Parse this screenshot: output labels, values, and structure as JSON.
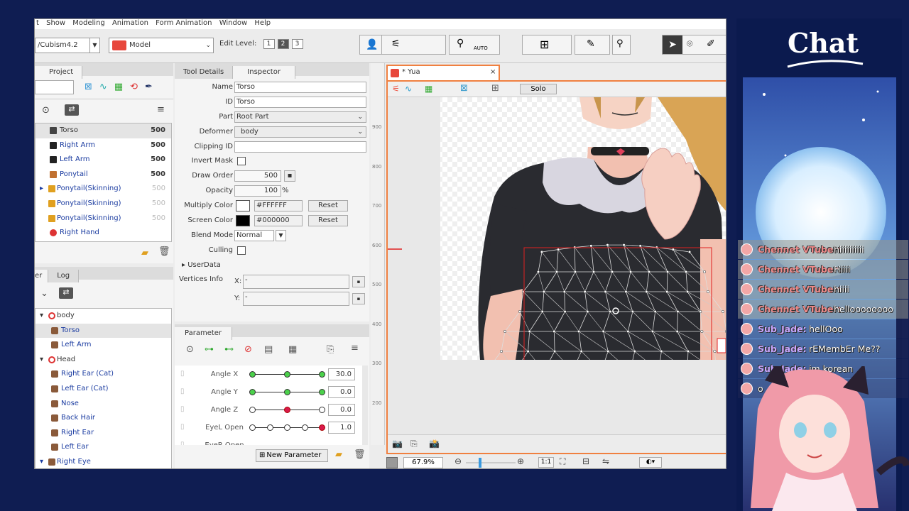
{
  "app": {
    "menu": [
      "t",
      "Show",
      "Modeling",
      "Animation",
      "Form Animation",
      "Window",
      "Help"
    ],
    "toolbar": {
      "project_path": "/Cubism4.2",
      "mode_select": "Model",
      "edit_level_label": "Edit Level:",
      "edit_levels": [
        "1",
        "2",
        "3"
      ],
      "active_edit_level": "2",
      "auto_label": "AUTO"
    },
    "project_panel": {
      "tab": "Project",
      "parts": [
        {
          "label": "Torso",
          "value": "500",
          "selected": true,
          "dim": false
        },
        {
          "label": "Right Arm",
          "value": "500",
          "selected": false,
          "dim": false
        },
        {
          "label": "Left Arm",
          "value": "500",
          "selected": false,
          "dim": false
        },
        {
          "label": "Ponytail",
          "value": "500",
          "selected": false,
          "dim": false
        },
        {
          "label": "Ponytail(Skinning)",
          "value": "500",
          "selected": false,
          "dim": true
        },
        {
          "label": "Ponytail(Skinning)",
          "value": "500",
          "selected": false,
          "dim": true
        },
        {
          "label": "Ponytail(Skinning)",
          "value": "500",
          "selected": false,
          "dim": true
        },
        {
          "label": "Right Hand",
          "value": "",
          "selected": false,
          "dim": false
        }
      ]
    },
    "deformer_panel": {
      "tabs": [
        "er",
        "Log"
      ],
      "items": [
        {
          "label": "body",
          "indent": 0,
          "color": "gray"
        },
        {
          "label": "Torso",
          "indent": 1,
          "color": "blue",
          "selected": true
        },
        {
          "label": "Left Arm",
          "indent": 1,
          "color": "blue"
        },
        {
          "label": "Head",
          "indent": 0,
          "color": "gray"
        },
        {
          "label": "Right Ear (Cat)",
          "indent": 1,
          "color": "blue"
        },
        {
          "label": "Left Ear (Cat)",
          "indent": 1,
          "color": "blue"
        },
        {
          "label": "Nose",
          "indent": 1,
          "color": "blue"
        },
        {
          "label": "Back Hair",
          "indent": 1,
          "color": "blue"
        },
        {
          "label": "Right Ear",
          "indent": 1,
          "color": "blue"
        },
        {
          "label": "Left Ear",
          "indent": 1,
          "color": "blue"
        },
        {
          "label": "Right Eye",
          "indent": 0,
          "color": "blue"
        }
      ]
    },
    "inspector": {
      "tabs": [
        "Tool Details",
        "Inspector"
      ],
      "name_label": "Name",
      "name": "Torso",
      "id_label": "ID",
      "id": "Torso",
      "part_label": "Part",
      "part": "Root Part",
      "deformer_label": "Deformer",
      "deformer": "body",
      "clipping_label": "Clipping ID",
      "clipping": "",
      "invert_mask_label": "Invert Mask",
      "draw_order_label": "Draw Order",
      "draw_order": "500",
      "opacity_label": "Opacity",
      "opacity": "100",
      "opacity_unit": "%",
      "multiply_label": "Multiply Color",
      "multiply_color": "#FFFFFF",
      "screen_label": "Screen Color",
      "screen_color": "#000000",
      "reset_label": "Reset",
      "blend_label": "Blend Mode",
      "blend": "Normal",
      "culling_label": "Culling",
      "userdata_label": "UserData",
      "vertices_label": "Vertices Info",
      "x_label": "X:",
      "x_value": "-",
      "y_label": "Y:",
      "y_value": "-"
    },
    "parameter": {
      "tab": "Parameter",
      "new_button": "New Parameter",
      "params": [
        {
          "name": "Angle X",
          "value": "30.0",
          "knobs": [
            "g",
            "g",
            "g"
          ],
          "active": 2
        },
        {
          "name": "Angle Y",
          "value": "0.0",
          "knobs": [
            "g",
            "g",
            "g"
          ],
          "active": 1
        },
        {
          "name": "Angle Z",
          "value": "0.0",
          "knobs": [
            "w",
            "r",
            "w"
          ],
          "active": 1
        },
        {
          "name": "EyeL Open",
          "value": "1.0",
          "knobs": [
            "w",
            "w",
            "w",
            "w",
            "r"
          ],
          "active": 4
        },
        {
          "name": "EyeR Open",
          "value": "",
          "knobs": [],
          "active": 0
        }
      ]
    },
    "viewport": {
      "tab_title": "* Yua",
      "solo_label": "Solo",
      "ruler": [
        "900",
        "800",
        "700",
        "600",
        "500",
        "400",
        "300",
        "200"
      ],
      "zoom": "67.9",
      "zoom_unit": "%",
      "ratio_label": "1:1"
    }
  },
  "chat": {
    "title": "Chat",
    "messages": [
      {
        "user": "Chennet VTuber:",
        "text": "hiiiiiiiiii",
        "color": "#f08a8a"
      },
      {
        "user": "Chennet VTuber:",
        "text": "Hiiii",
        "color": "#f08a8a"
      },
      {
        "user": "Chennet VTuber:",
        "text": "hiiii",
        "color": "#f08a8a"
      },
      {
        "user": "Chennet VTuber:",
        "text": "helloooooooo",
        "color": "#f08a8a"
      },
      {
        "user": "Sub_Jade:",
        "text": "hellOoo",
        "color": "#c9a6ff"
      },
      {
        "user": "Sub_Jade:",
        "text": "rEMembEr Me??",
        "color": "#c9a6ff"
      },
      {
        "user": "Sub_Jade:",
        "text": "im korean",
        "color": "#c9a6ff"
      },
      {
        "user": "",
        "text": "o",
        "color": "#f08a8a"
      }
    ]
  }
}
